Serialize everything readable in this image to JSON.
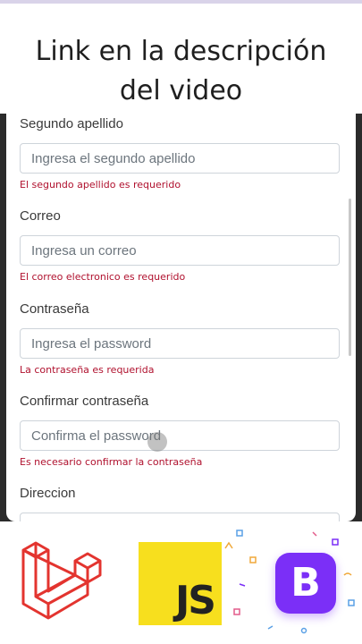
{
  "overlay": {
    "headline_line1": "Link en la descripción",
    "headline_line2": "del video"
  },
  "form": {
    "fields": [
      {
        "label": "Segundo apellido",
        "placeholder": "Ingresa el segundo apellido",
        "error": "El segundo apellido es requerido"
      },
      {
        "label": "Correo",
        "placeholder": "Ingresa un correo",
        "error": "El correo electronico es requerido"
      },
      {
        "label": "Contraseña",
        "placeholder": "Ingresa el password",
        "error": "La contraseña es requerida"
      },
      {
        "label": "Confirmar contraseña",
        "placeholder": "Confirma el password",
        "error": "Es necesario confirmar la contraseña"
      },
      {
        "label": "Direccion",
        "placeholder": "",
        "error": ""
      }
    ]
  },
  "logos": {
    "laravel_icon": "laravel-icon",
    "js_text": "JS",
    "bootstrap_text": "B"
  },
  "colors": {
    "error": "#b0112e",
    "laravel": "#e3342f",
    "javascript": "#f7df1e",
    "bootstrap": "#7b2ff7"
  }
}
